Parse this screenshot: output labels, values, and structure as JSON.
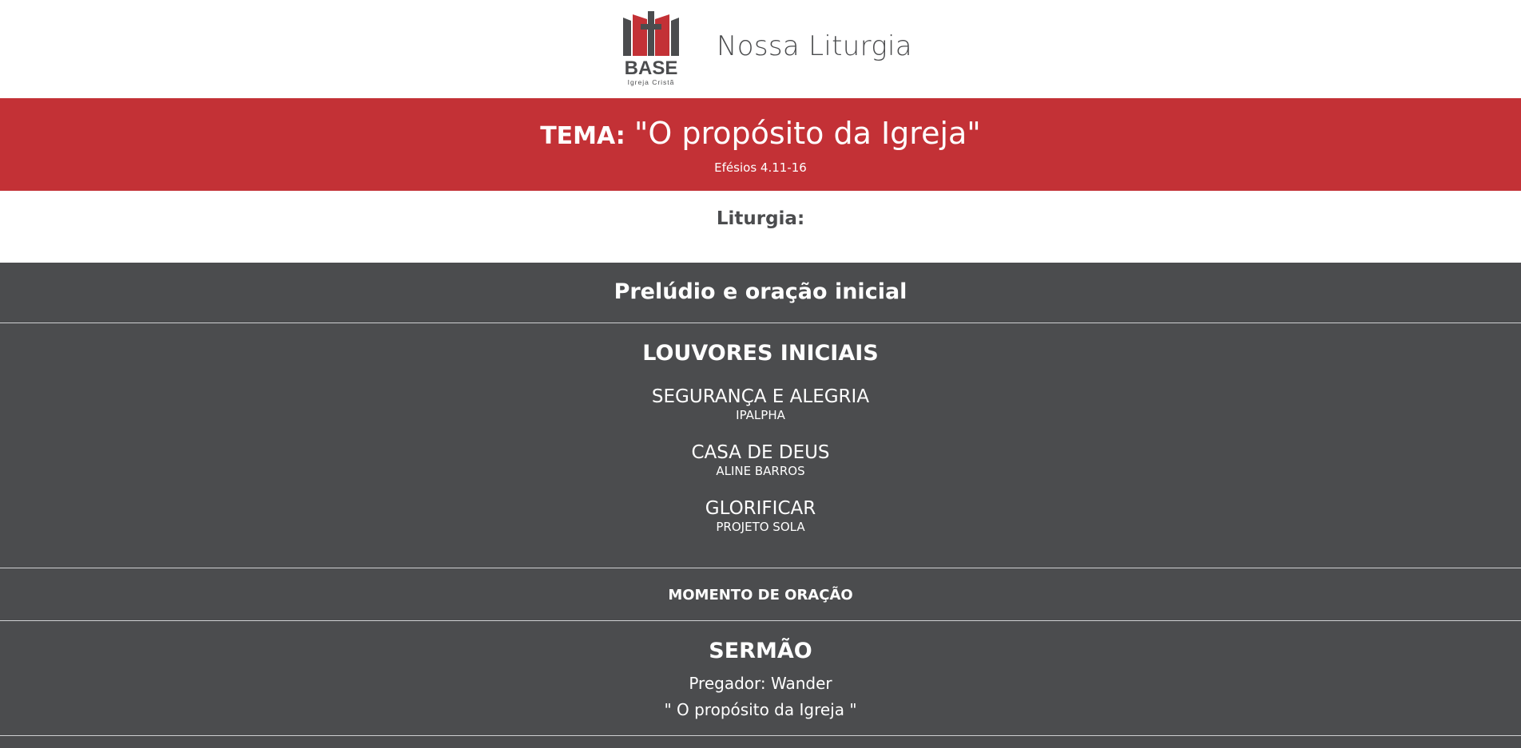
{
  "header": {
    "title": "Nossa Liturgia",
    "logo": {
      "name": "BASE",
      "subtitle": "Igreja Cristã",
      "brand_red": "#c33136",
      "brand_gray": "#4b4c4e"
    }
  },
  "theme": {
    "label": "TEMA:",
    "title": "\"O propósito da Igreja\"",
    "reference": "Efésios 4.11-16",
    "background": "#c33136"
  },
  "liturgy": {
    "heading": "Liturgia:"
  },
  "sections": {
    "prelude": {
      "title": "Prelúdio e oração inicial"
    },
    "songs": {
      "title": "LOUVORES INICIAIS",
      "items": [
        {
          "title": "SEGURANÇA E ALEGRIA",
          "artist": "IPALPHA"
        },
        {
          "title": "CASA DE DEUS",
          "artist": "ALINE BARROS"
        },
        {
          "title": "GLORIFICAR",
          "artist": "PROJETO SOLA"
        }
      ]
    },
    "prayer": {
      "title": "MOMENTO DE ORAÇÃO"
    },
    "sermon": {
      "title": "SERMÃO",
      "preacher": "Pregador: Wander",
      "sermon_title": "\" O propósito da Igreja \""
    }
  },
  "colors": {
    "dark_section": "#4b4c4e",
    "separator": "#cfd0d2"
  }
}
